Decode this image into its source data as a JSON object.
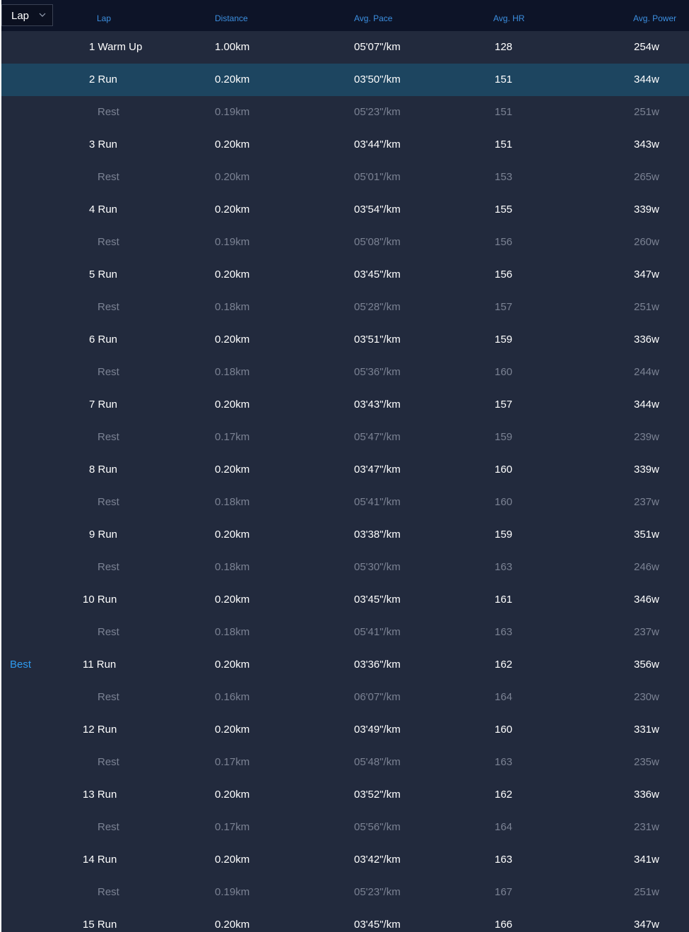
{
  "selector": {
    "value": "Lap",
    "icon": "chevron-down-icon"
  },
  "columns": {
    "lap": "Lap",
    "distance": "Distance",
    "pace": "Avg. Pace",
    "hr": "Avg. HR",
    "power": "Avg. Power"
  },
  "colors": {
    "background": "#222a3d",
    "header": "#0d1428",
    "accent": "#2f9bf0",
    "selected_row": "#1d4560",
    "rest_text": "#7b8293",
    "run_text": "#ffffff"
  },
  "selected_lap": "2 Run",
  "rows": [
    {
      "kind": "run",
      "badge": "",
      "lap": "1 Warm Up",
      "distance": "1.00km",
      "pace": "05'07\"/km",
      "hr": "128",
      "power": "254w"
    },
    {
      "kind": "run",
      "badge": "",
      "lap": "2 Run",
      "distance": "0.20km",
      "pace": "03'50\"/km",
      "hr": "151",
      "power": "344w"
    },
    {
      "kind": "rest",
      "badge": "",
      "lap": "Rest",
      "distance": "0.19km",
      "pace": "05'23\"/km",
      "hr": "151",
      "power": "251w"
    },
    {
      "kind": "run",
      "badge": "",
      "lap": "3 Run",
      "distance": "0.20km",
      "pace": "03'44\"/km",
      "hr": "151",
      "power": "343w"
    },
    {
      "kind": "rest",
      "badge": "",
      "lap": "Rest",
      "distance": "0.20km",
      "pace": "05'01\"/km",
      "hr": "153",
      "power": "265w"
    },
    {
      "kind": "run",
      "badge": "",
      "lap": "4 Run",
      "distance": "0.20km",
      "pace": "03'54\"/km",
      "hr": "155",
      "power": "339w"
    },
    {
      "kind": "rest",
      "badge": "",
      "lap": "Rest",
      "distance": "0.19km",
      "pace": "05'08\"/km",
      "hr": "156",
      "power": "260w"
    },
    {
      "kind": "run",
      "badge": "",
      "lap": "5 Run",
      "distance": "0.20km",
      "pace": "03'45\"/km",
      "hr": "156",
      "power": "347w"
    },
    {
      "kind": "rest",
      "badge": "",
      "lap": "Rest",
      "distance": "0.18km",
      "pace": "05'28\"/km",
      "hr": "157",
      "power": "251w"
    },
    {
      "kind": "run",
      "badge": "",
      "lap": "6 Run",
      "distance": "0.20km",
      "pace": "03'51\"/km",
      "hr": "159",
      "power": "336w"
    },
    {
      "kind": "rest",
      "badge": "",
      "lap": "Rest",
      "distance": "0.18km",
      "pace": "05'36\"/km",
      "hr": "160",
      "power": "244w"
    },
    {
      "kind": "run",
      "badge": "",
      "lap": "7 Run",
      "distance": "0.20km",
      "pace": "03'43\"/km",
      "hr": "157",
      "power": "344w"
    },
    {
      "kind": "rest",
      "badge": "",
      "lap": "Rest",
      "distance": "0.17km",
      "pace": "05'47\"/km",
      "hr": "159",
      "power": "239w"
    },
    {
      "kind": "run",
      "badge": "",
      "lap": "8 Run",
      "distance": "0.20km",
      "pace": "03'47\"/km",
      "hr": "160",
      "power": "339w"
    },
    {
      "kind": "rest",
      "badge": "",
      "lap": "Rest",
      "distance": "0.18km",
      "pace": "05'41\"/km",
      "hr": "160",
      "power": "237w"
    },
    {
      "kind": "run",
      "badge": "",
      "lap": "9 Run",
      "distance": "0.20km",
      "pace": "03'38\"/km",
      "hr": "159",
      "power": "351w"
    },
    {
      "kind": "rest",
      "badge": "",
      "lap": "Rest",
      "distance": "0.18km",
      "pace": "05'30\"/km",
      "hr": "163",
      "power": "246w"
    },
    {
      "kind": "run",
      "badge": "",
      "lap": "10 Run",
      "distance": "0.20km",
      "pace": "03'45\"/km",
      "hr": "161",
      "power": "346w"
    },
    {
      "kind": "rest",
      "badge": "",
      "lap": "Rest",
      "distance": "0.18km",
      "pace": "05'41\"/km",
      "hr": "163",
      "power": "237w"
    },
    {
      "kind": "run",
      "badge": "Best",
      "lap": "11 Run",
      "distance": "0.20km",
      "pace": "03'36\"/km",
      "hr": "162",
      "power": "356w"
    },
    {
      "kind": "rest",
      "badge": "",
      "lap": "Rest",
      "distance": "0.16km",
      "pace": "06'07\"/km",
      "hr": "164",
      "power": "230w"
    },
    {
      "kind": "run",
      "badge": "",
      "lap": "12 Run",
      "distance": "0.20km",
      "pace": "03'49\"/km",
      "hr": "160",
      "power": "331w"
    },
    {
      "kind": "rest",
      "badge": "",
      "lap": "Rest",
      "distance": "0.17km",
      "pace": "05'48\"/km",
      "hr": "163",
      "power": "235w"
    },
    {
      "kind": "run",
      "badge": "",
      "lap": "13 Run",
      "distance": "0.20km",
      "pace": "03'52\"/km",
      "hr": "162",
      "power": "336w"
    },
    {
      "kind": "rest",
      "badge": "",
      "lap": "Rest",
      "distance": "0.17km",
      "pace": "05'56\"/km",
      "hr": "164",
      "power": "231w"
    },
    {
      "kind": "run",
      "badge": "",
      "lap": "14 Run",
      "distance": "0.20km",
      "pace": "03'42\"/km",
      "hr": "163",
      "power": "341w"
    },
    {
      "kind": "rest",
      "badge": "",
      "lap": "Rest",
      "distance": "0.19km",
      "pace": "05'23\"/km",
      "hr": "167",
      "power": "251w"
    },
    {
      "kind": "run",
      "badge": "",
      "lap": "15 Run",
      "distance": "0.20km",
      "pace": "03'45\"/km",
      "hr": "166",
      "power": "347w"
    }
  ]
}
